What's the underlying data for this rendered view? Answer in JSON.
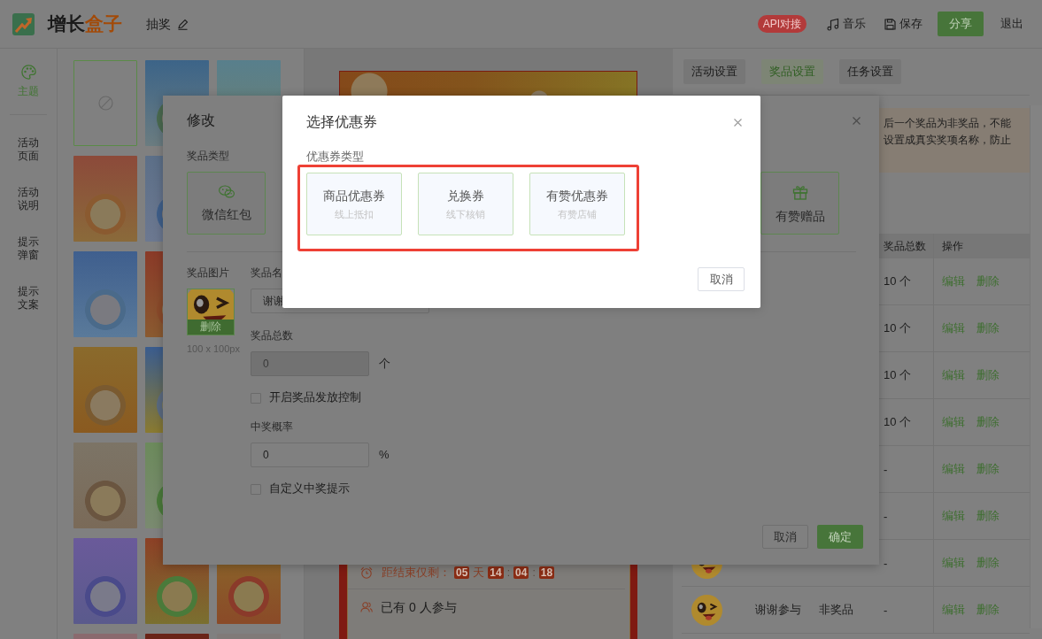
{
  "header": {
    "logo_text": {
      "main": "增长",
      "accent": "盒子"
    },
    "activity_name": "抽奖",
    "api_badge": "API对接",
    "music_button": "音乐",
    "save_button": "保存",
    "share_button": "分享",
    "logout_link": "退出"
  },
  "sidebar": {
    "items": [
      {
        "kind": "icon",
        "label": "主题",
        "selected": true
      },
      {
        "kind": "text",
        "label": "活动页面",
        "selected": false
      },
      {
        "kind": "text",
        "label": "活动说明",
        "selected": false
      },
      {
        "kind": "text",
        "label": "提示弹窗",
        "selected": false
      },
      {
        "kind": "text",
        "label": "提示文案",
        "selected": false
      }
    ]
  },
  "templates": {
    "rows": [
      {
        "items": [
          {
            "kind": "none",
            "selected": true
          },
          {
            "kind": "image",
            "selected": false
          },
          {
            "kind": "image",
            "selected": false
          }
        ]
      },
      {
        "items": [
          {
            "kind": "image",
            "selected": false
          },
          {
            "kind": "image",
            "selected": false
          }
        ]
      },
      {
        "items": [
          {
            "kind": "image",
            "selected": false
          },
          {
            "kind": "image",
            "selected": false
          }
        ]
      },
      {
        "items": [
          {
            "kind": "image",
            "selected": false
          },
          {
            "kind": "image",
            "selected": false
          }
        ]
      },
      {
        "items": [
          {
            "kind": "image",
            "selected": false
          },
          {
            "kind": "image",
            "selected": false
          }
        ]
      },
      {
        "items": [
          {
            "kind": "image",
            "selected": false
          },
          {
            "kind": "image",
            "selected": false
          },
          {
            "kind": "image",
            "selected": false
          }
        ]
      },
      {
        "items": [
          {
            "kind": "image",
            "selected": false
          },
          {
            "kind": "image",
            "selected": false
          },
          {
            "kind": "image",
            "selected": false
          }
        ]
      }
    ]
  },
  "preview": {
    "countdown_label": "距结束仅剩：",
    "countdown": [
      {
        "kind": "number",
        "text": "05"
      },
      {
        "kind": "unit",
        "text": "天"
      },
      {
        "kind": "number",
        "text": "14"
      },
      {
        "kind": "separator",
        "text": ":"
      },
      {
        "kind": "number",
        "text": "04"
      },
      {
        "kind": "separator",
        "text": ":"
      },
      {
        "kind": "number",
        "text": "18"
      }
    ],
    "participants": "已有 0 人参与"
  },
  "right_panel": {
    "tabs": [
      {
        "label": "活动设置",
        "selected": false
      },
      {
        "label": "奖品设置",
        "selected": true
      },
      {
        "label": "任务设置",
        "selected": false
      }
    ],
    "notice_lines": [
      "后一个奖品为非奖品，不能",
      "设置成真实奖项名称，防止"
    ],
    "table": {
      "columns": [
        "奖品总数",
        "操作"
      ],
      "rows": [
        {
          "total": "10 个",
          "actions": [
            "编辑",
            "删除"
          ]
        },
        {
          "total": "10 个",
          "actions": [
            "编辑",
            "删除"
          ]
        },
        {
          "total": "10 个",
          "actions": [
            "编辑",
            "删除"
          ]
        },
        {
          "total": "10 个",
          "actions": [
            "编辑",
            "删除"
          ]
        },
        {
          "total": "-",
          "actions": [
            "编辑",
            "删除"
          ]
        },
        {
          "total": "-",
          "actions": [
            "编辑",
            "删除"
          ]
        },
        {
          "avatar": true,
          "total": "-",
          "actions": [
            "编辑",
            "删除"
          ]
        },
        {
          "avatar": true,
          "name": "谢谢参与",
          "type": "非奖品",
          "total": "-",
          "actions": [
            "编辑",
            "删除"
          ]
        }
      ]
    }
  },
  "edit_dialog": {
    "title": "修改",
    "prize_type_label": "奖品类型",
    "wechat_card": "微信红包",
    "gift_card": "有赞赠品",
    "image_label": "奖品图片",
    "image_delete_button": "删除",
    "image_hint": "100 x 100px",
    "name_label": "奖品名",
    "name_field": {
      "value": "谢谢"
    },
    "total_label": "奖品总数",
    "total_field": {
      "value": "0",
      "disabled": true
    },
    "total_unit": "个",
    "limit_option": {
      "label": "开启奖品发放控制",
      "checked": false
    },
    "rate_label": "中奖概率",
    "rate_field": {
      "value": "0",
      "disabled": false
    },
    "rate_unit": "%",
    "tip_option": {
      "label": "自定义中奖提示",
      "checked": false
    },
    "cancel_button": "取消",
    "confirm_button": "确定"
  },
  "coupon_dialog": {
    "title": "选择优惠券",
    "type_label": "优惠券类型",
    "types": [
      {
        "title": "商品优惠券",
        "subtitle": "线上抵扣"
      },
      {
        "title": "兑换券",
        "subtitle": "线下核销"
      },
      {
        "title": "有赞优惠券",
        "subtitle": "有赞店铺"
      }
    ],
    "cancel_button": "取消"
  }
}
